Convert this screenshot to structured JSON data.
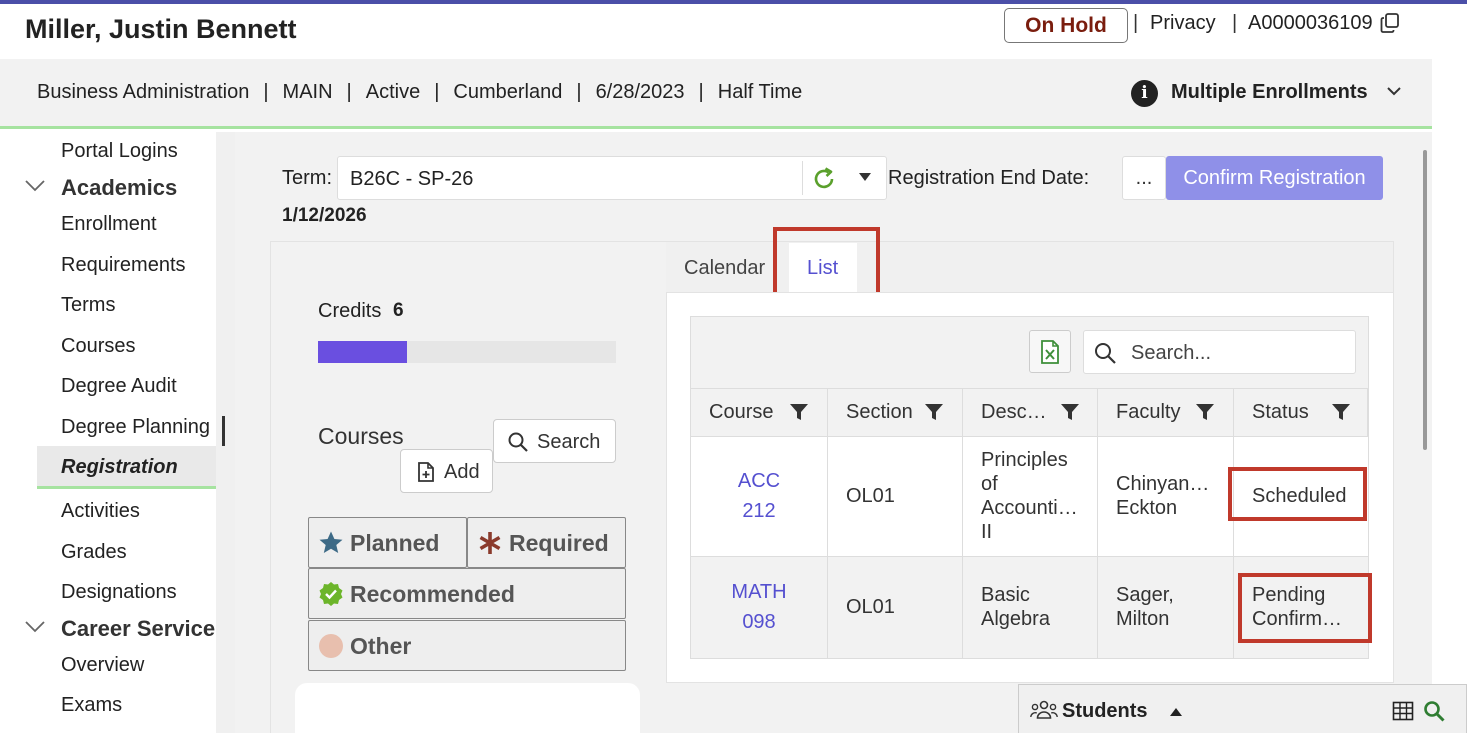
{
  "header": {
    "student_name": "Miller, Justin Bennett",
    "hold_badge": "On Hold",
    "sep1": "|",
    "privacy": "Privacy",
    "sep2": "|",
    "student_id": "A0000036109"
  },
  "enrollment": {
    "program": "Business Administration",
    "campus": "MAIN",
    "status": "Active",
    "location": "Cumberland",
    "date": "6/28/2023",
    "load": "Half Time",
    "separator": "|",
    "multiple_label": "Multiple Enrollments"
  },
  "sidebar": {
    "items_top": [
      "Portal Logins"
    ],
    "group_academics": "Academics",
    "academics_items": [
      "Enrollment",
      "Requirements",
      "Terms",
      "Courses",
      "Degree Audit",
      "Degree Planning"
    ],
    "active_item": "Registration",
    "academics_items_after": [
      "Activities",
      "Grades",
      "Designations"
    ],
    "group_career": "Career Service",
    "career_items": [
      "Overview",
      "Exams"
    ]
  },
  "registration": {
    "term_label": "Term:",
    "term_value": "B26C - SP-26",
    "end_date_label": "Registration End Date:",
    "end_date_value": "1/12/2026",
    "more_button": "...",
    "confirm_button": "Confirm Registration"
  },
  "credits": {
    "label": "Credits",
    "value": "6",
    "progress_fraction": 0.3
  },
  "courses_panel": {
    "title": "Courses",
    "search_button": "Search",
    "add_button": "Add",
    "legend": {
      "planned": "Planned",
      "required": "Required",
      "recommended": "Recommended",
      "other": "Other"
    }
  },
  "tabs": {
    "calendar": "Calendar",
    "list": "List",
    "active": "List"
  },
  "grid": {
    "search_placeholder": "Search...",
    "columns": [
      "Course",
      "Section",
      "Desc…",
      "Faculty",
      "Status"
    ],
    "rows": [
      {
        "course_line1": "ACC",
        "course_line2": "212",
        "section": "OL01",
        "desc_lines": [
          "Principles",
          "of",
          "Accounti…",
          "II"
        ],
        "faculty_lines": [
          "Chinyan…",
          "Eckton"
        ],
        "status_lines": [
          "Scheduled"
        ]
      },
      {
        "course_line1": "MATH",
        "course_line2": "098",
        "section": "OL01",
        "desc_lines": [
          "Basic",
          "Algebra"
        ],
        "faculty_lines": [
          "Sager,",
          "Milton"
        ],
        "status_lines": [
          "Pending",
          "Confirm…"
        ]
      }
    ]
  },
  "bottom_bar": {
    "students_label": "Students"
  },
  "colors": {
    "accent_green": "#a6e3a0",
    "confirm_button_bg": "#8f90e8",
    "progress_fill": "#6a4fe0",
    "link": "#5550d0",
    "highlight_red": "#c0392b",
    "hold_text": "#7a1d0e"
  }
}
